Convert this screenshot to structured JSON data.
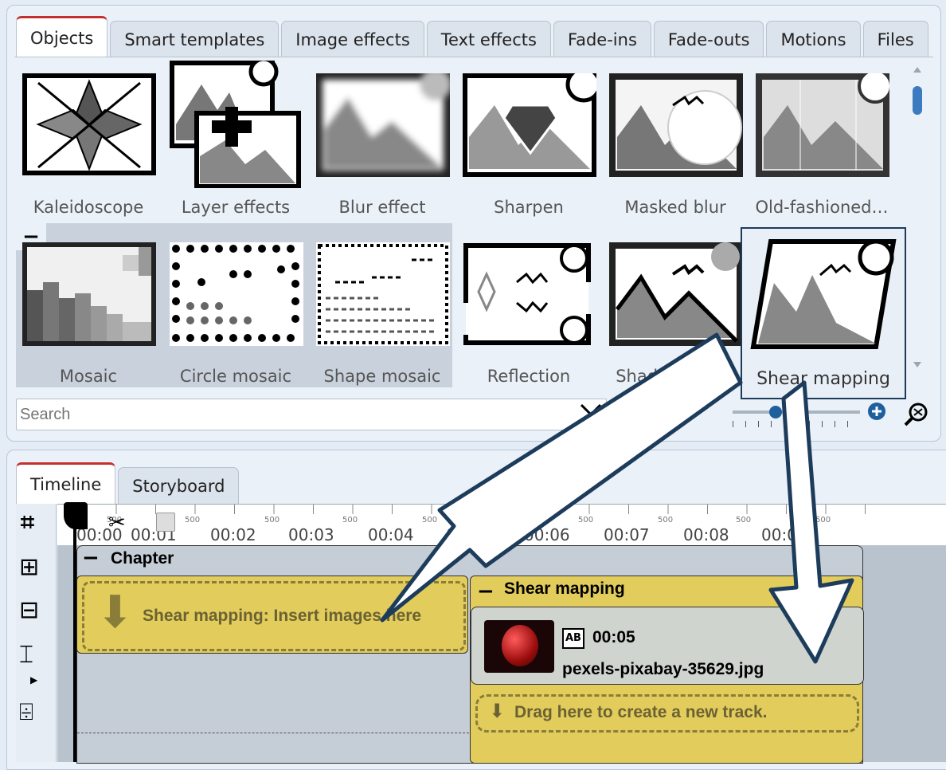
{
  "toolbox": {
    "tabs": [
      "Objects",
      "Smart templates",
      "Image effects",
      "Text effects",
      "Fade-ins",
      "Fade-outs",
      "Motions",
      "Files"
    ],
    "active_tab": "Objects",
    "items_row1": [
      "Kaleidoscope",
      "Layer effects",
      "Blur effect",
      "Sharpen",
      "Masked blur",
      "Old-fashioned…"
    ],
    "items_row2": [
      "Mosaic",
      "Circle mosaic",
      "Shape mosaic",
      "Reflection",
      "Shadow effect"
    ],
    "group_collapse": "−",
    "tooltip": "Shear mapping",
    "search": {
      "placeholder": "Search",
      "value": ""
    }
  },
  "timeline": {
    "tabs": [
      "Timeline",
      "Storyboard"
    ],
    "active_tab": "Timeline",
    "ticks": [
      "00:00",
      "00:01",
      "00:02",
      "00:03",
      "00:04",
      "00:05",
      "00:06",
      "00:07",
      "00:08",
      "00:0"
    ],
    "half_marks": [
      "500",
      "500",
      "500",
      "500",
      "500",
      "500",
      "500",
      "500",
      "500",
      "500"
    ],
    "chapter_label": "Chapter",
    "chapter_collapse": "−",
    "insert_placeholder": "Shear mapping: Insert images here",
    "effect_label": "Shear mapping",
    "clip": {
      "duration": "00:05",
      "filename": "pexels-pixabay-35629.jpg"
    },
    "drag_hint": "Drag here to create a new track."
  },
  "colors": {
    "accent_red": "#c43030",
    "effect_yellow": "#e2cc5c",
    "arrow_outline": "#1d3c5c"
  }
}
